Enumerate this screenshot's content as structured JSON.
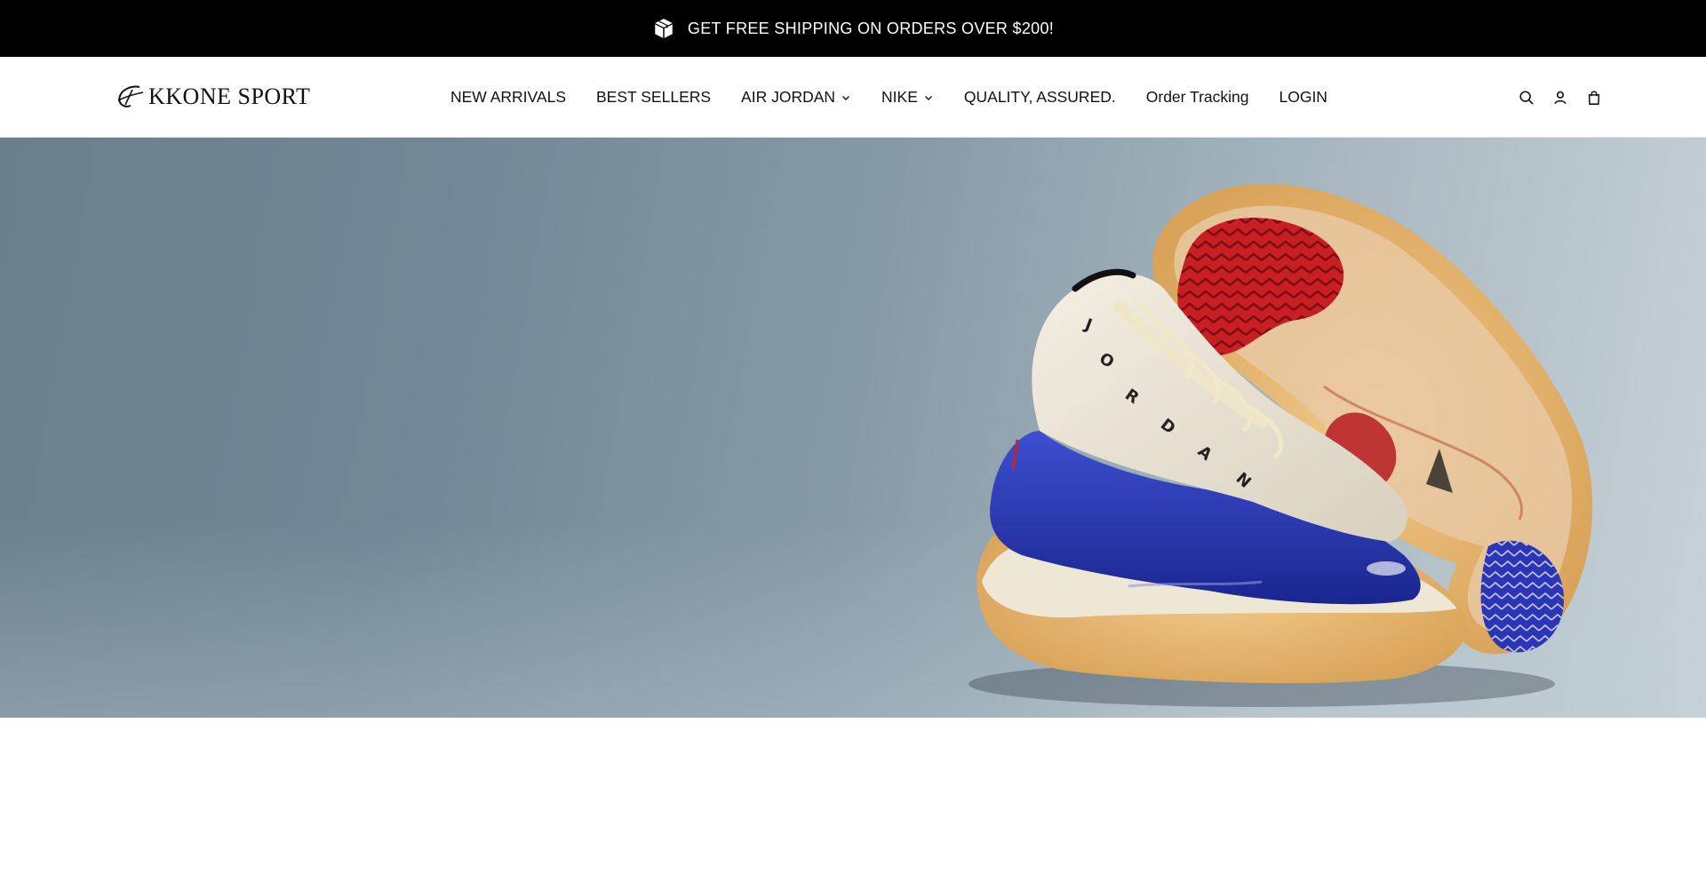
{
  "announcement": {
    "text": "GET FREE SHIPPING ON ORDERS OVER $200!",
    "icon": "package-icon"
  },
  "header": {
    "logo_text": "KKONE SPORT",
    "nav": [
      {
        "label": "NEW ARRIVALS",
        "has_dropdown": false
      },
      {
        "label": "BEST SELLERS",
        "has_dropdown": false
      },
      {
        "label": "AIR JORDAN",
        "has_dropdown": true
      },
      {
        "label": "NIKE",
        "has_dropdown": true
      },
      {
        "label": "QUALITY, ASSURED.",
        "has_dropdown": false
      },
      {
        "label": "Order Tracking",
        "has_dropdown": false
      },
      {
        "label": "LOGIN",
        "has_dropdown": false
      }
    ],
    "icons": [
      "search-icon",
      "account-icon",
      "cart-icon"
    ]
  },
  "hero": {
    "image": "sneaker-photo",
    "shoe_text": "JORDAN"
  },
  "colors": {
    "announcement_bg": "#000000",
    "announcement_text": "#ffffff",
    "text": "#111111",
    "hero_bg": "#7a8e9b"
  }
}
